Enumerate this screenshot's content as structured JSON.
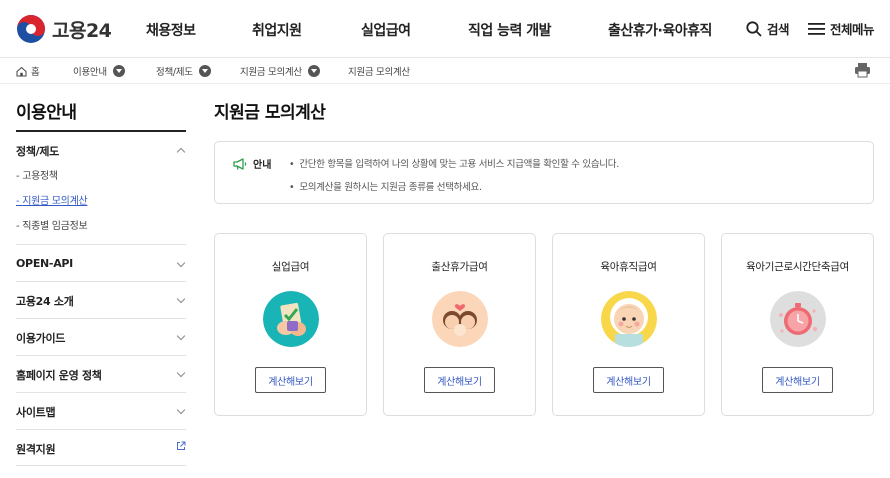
{
  "header": {
    "logo_text": "고용24",
    "nav": [
      "채용정보",
      "취업지원",
      "실업급여",
      "직업 능력 개발",
      "출산휴가·육아휴직"
    ],
    "search_label": "검색",
    "menu_label": "전체메뉴"
  },
  "breadcrumb": {
    "home": "홈",
    "items": [
      "이용안내",
      "정책/제도",
      "지원금 모의계산"
    ],
    "current": "지원금 모의계산"
  },
  "sidebar": {
    "title": "이용안내",
    "groups": [
      {
        "label": "정책/제도",
        "sub": [
          "고용정책",
          "지원금 모의계산",
          "직종별 임금정보"
        ],
        "active": "지원금 모의계산"
      },
      {
        "label": "OPEN-API"
      },
      {
        "label": "고용24 소개"
      },
      {
        "label": "이용가이드"
      },
      {
        "label": "홈페이지 운영 정책"
      },
      {
        "label": "사이트맵"
      },
      {
        "label": "원격지원"
      }
    ]
  },
  "main": {
    "title": "지원금 모의계산",
    "notice": {
      "label": "안내",
      "lines": [
        "간단한 항목을 입력하여 나의 상황에 맞는 고용 서비스 지급액을 확인할 수 있습니다.",
        "모의계산을 원하시는 지원금 종류를 선택하세요."
      ]
    },
    "cards": [
      {
        "title": "실업급여",
        "button": "계산해보기",
        "icon": "unemployment-benefit-icon"
      },
      {
        "title": "출산휴가급여",
        "button": "계산해보기",
        "icon": "maternity-leave-icon"
      },
      {
        "title": "육아휴직급여",
        "button": "계산해보기",
        "icon": "parental-leave-icon"
      },
      {
        "title": "육아기근로시간단축급여",
        "button": "계산해보기",
        "icon": "reduced-hours-icon"
      }
    ]
  },
  "colors": {
    "link_blue": "#3559c4",
    "notice_icon_green": "#2e9e4f"
  }
}
